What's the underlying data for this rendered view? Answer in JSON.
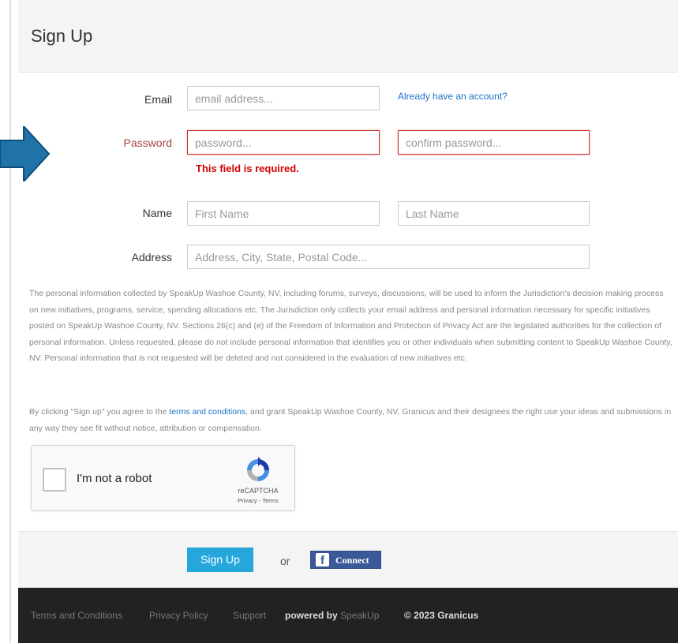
{
  "panel": {
    "title": "Sign Up"
  },
  "form": {
    "email": {
      "label": "Email",
      "placeholder": "email address..."
    },
    "already_link": "Already have an account?",
    "password": {
      "label": "Password",
      "placeholder": "password...",
      "confirm_placeholder": "confirm password...",
      "error": "This field is required."
    },
    "name": {
      "label": "Name",
      "first_placeholder": "First Name",
      "last_placeholder": "Last Name"
    },
    "address": {
      "label": "Address",
      "placeholder": "Address, City, State, Postal Code..."
    }
  },
  "privacy_text": "The personal information collected by SpeakUp Washoe County, NV, including forums, surveys, discussions, will be used to inform the Jurisdiction's decision making process on new initiatives, programs, service, spending allocations etc. The Jurisdiction only collects your email address and personal information necessary for specific initiatives posted on SpeakUp Washoe County, NV. Sections 26(c) and (e) of the Freedom of Information and Protection of Privacy Act are the legislated authorities for the collection of personal information. Unless requested, please do not include personal information that identifies you or other individuals when submitting content to SpeakUp Washoe County, NV. Personal information that is not requested will be deleted and not considered in the evaluation of new initiatives etc.",
  "consent": {
    "before": "By clicking \"Sign up\" you agree to the ",
    "link": "terms and conditions",
    "after": ", and grant SpeakUp Washoe County, NV, Granicus and their designees the right use your ideas and submissions in any way they see fit without notice, attribution or compensation."
  },
  "captcha": {
    "label": "I'm not a robot",
    "brand": "reCAPTCHA",
    "privacy": "Privacy",
    "separator": " - ",
    "terms": "Terms"
  },
  "actions": {
    "signup": "Sign Up",
    "or": "or",
    "fb_icon": "f",
    "fb_connect": "Connect"
  },
  "footer": {
    "terms": "Terms and Conditions",
    "privacy": "Privacy Policy",
    "support": "Support",
    "powered_by": "powered by",
    "powered_brand": "SpeakUp",
    "copyright": "© 2023 Granicus"
  },
  "colors": {
    "accent": "#25a7dc",
    "error": "#d40000",
    "facebook": "#3b5998",
    "arrow": "#1f73a8",
    "footer_bg": "#222222"
  },
  "icons": {
    "arrow": "right-arrow-icon",
    "captcha": "recaptcha-icon",
    "facebook": "facebook-icon"
  }
}
